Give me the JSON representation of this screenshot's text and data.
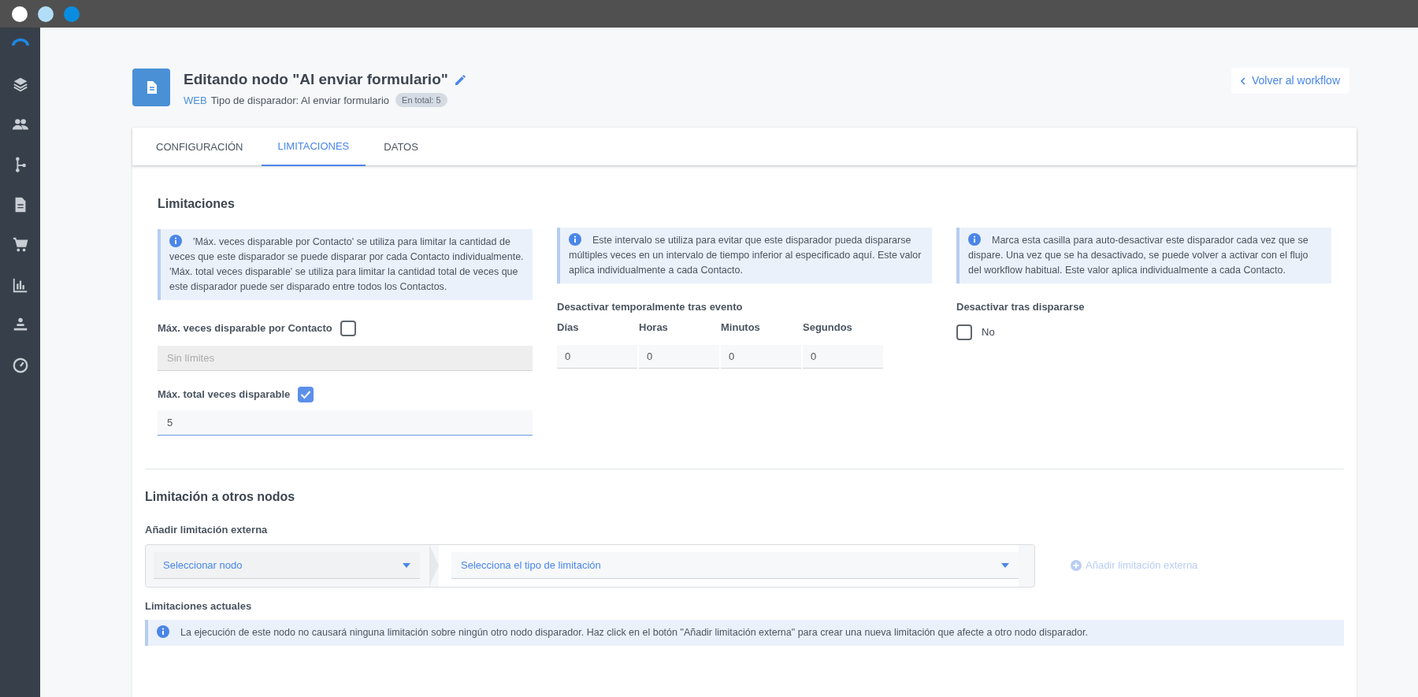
{
  "window": {
    "controls": [
      {
        "color": "#ffffff"
      },
      {
        "color": "#b3ddf7"
      },
      {
        "color": "#0a8de0"
      }
    ]
  },
  "header": {
    "title": "Editando nodo \"Al enviar formulario\"",
    "source": "WEB",
    "subtitle": "Tipo de disparador: Al enviar formulario",
    "badge": "En total: 5",
    "back_button": "Volver al workflow"
  },
  "tabs": [
    {
      "label": "CONFIGURACIÓN",
      "selected": false
    },
    {
      "label": "LIMITACIONES",
      "selected": true
    },
    {
      "label": "DATOS",
      "selected": false
    }
  ],
  "limits": {
    "heading": "Limitaciones",
    "info": "'Máx. veces disparable por Contacto' se utiliza para limitar la cantidad de veces que este disparador se puede disparar por cada Contacto individualmente. 'Máx. total veces disparable' se utiliza para limitar la cantidad total de veces que este disparador puede ser disparado entre todos los Contactos.",
    "per_contact": {
      "label": "Máx. veces disparable por Contacto",
      "checked": false,
      "placeholder": "Sin límites",
      "disabled": true
    },
    "total": {
      "label": "Máx. total veces disparable",
      "checked": true,
      "value": "5",
      "disabled": false
    }
  },
  "interval": {
    "info": "Este intervalo se utiliza para evitar que este disparador pueda dispararse múltiples veces en un intervalo de tiempo inferior al especificado aquí. Este valor aplica individualmente a cada Contacto.",
    "label": "Desactivar temporalmente tras evento",
    "fields": [
      {
        "label": "Días",
        "value": "0"
      },
      {
        "label": "Horas",
        "value": "0"
      },
      {
        "label": "Minutos",
        "value": "0"
      },
      {
        "label": "Segundos",
        "value": "0"
      }
    ]
  },
  "deactivate": {
    "info": "Marca esta casilla para auto-desactivar este disparador cada vez que se dispare. Una vez que se ha desactivado, se puede volver a activar con el flujo del workflow habitual. Este valor aplica individualmente a cada Contacto.",
    "label": "Desactivar tras dispararse",
    "option": "No",
    "checked": false
  },
  "external": {
    "heading": "Limitación a otros nodos",
    "label": "Añadir limitación externa",
    "node_select": "Seleccionar nodo",
    "type_select": "Selecciona el tipo de limitación",
    "add_button": {
      "label": "Añadir limitación externa",
      "disabled": true
    },
    "current_label": "Limitaciones actuales",
    "current_info": "La ejecución de este nodo no causará ninguna limitación sobre ningún otro nodo disparador. Haz click en el botón \"Añadir limitación externa\" para crear una nueva limitación que afecte a otro nodo disparador."
  }
}
